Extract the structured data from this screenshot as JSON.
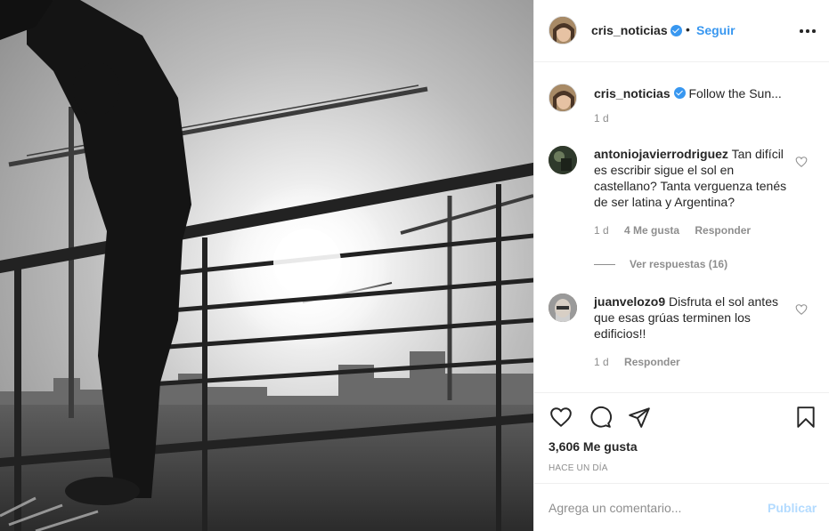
{
  "post": {
    "image_alt": "Mujer estirándose frente a una baranda con grúas y sol al fondo (blanco y negro)"
  },
  "header": {
    "username": "cris_noticias",
    "separator": "•",
    "follow_label": "Seguir",
    "more_icon": "more-options-icon"
  },
  "caption": {
    "username": "cris_noticias",
    "text": "Follow the Sun...",
    "age": "1 d"
  },
  "comments": [
    {
      "username": "antoniojavierrodriguez",
      "text": "Tan difícil es escribir sigue el sol en castellano? Tanta verguenza tenés de ser latina y Argentina?",
      "age": "1 d",
      "likes": "4 Me gusta",
      "reply_label": "Responder",
      "view_replies": "Ver respuestas (16)"
    },
    {
      "username": "juanvelozo9",
      "text": "Disfruta el sol antes que esas grúas terminen los edificios!!",
      "age": "1 d",
      "reply_label": "Responder"
    }
  ],
  "actions": {
    "icons": [
      "heart-icon",
      "comment-icon",
      "share-icon",
      "bookmark-icon"
    ],
    "likes_count": "3,606 Me gusta",
    "timestamp": "HACE UN DÍA"
  },
  "composer": {
    "placeholder": "Agrega un comentario...",
    "post_label": "Publicar"
  },
  "colors": {
    "link": "#3897f0",
    "post_disabled": "#b3dbff",
    "text": "#262626",
    "muted": "#8e8e8e",
    "border": "#efefef"
  }
}
